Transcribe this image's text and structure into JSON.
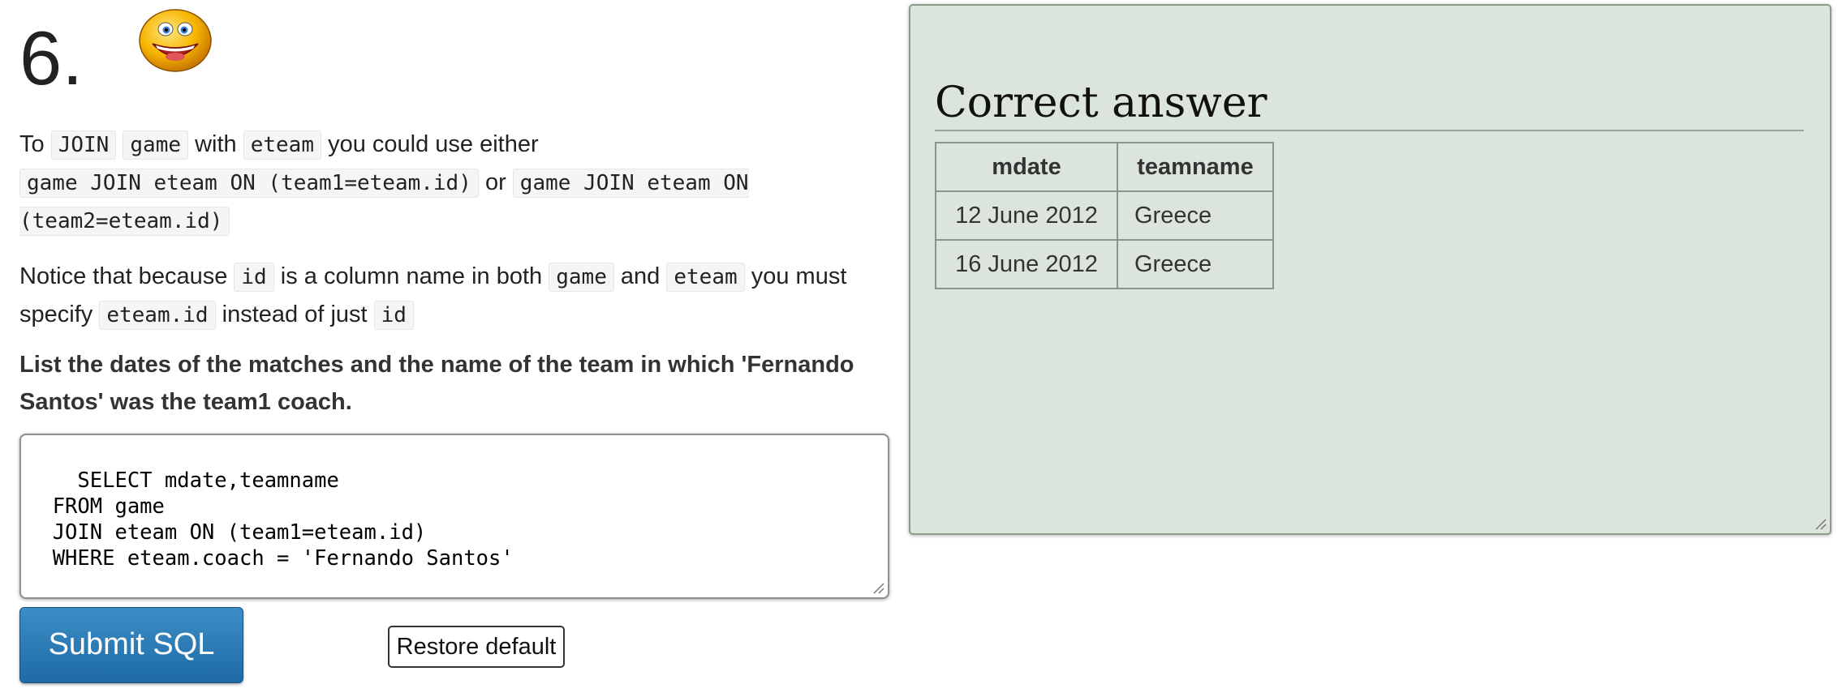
{
  "question_number": "6.",
  "smiley_icon": "grinning-smiley-icon",
  "intro": {
    "p1_to": "To",
    "p1_code_join": "JOIN",
    "p1_code_game": "game",
    "p1_with": "with",
    "p1_code_eteam": "eteam",
    "p1_either": "you could use either",
    "p1_code_option1": "game JOIN eteam ON (team1=eteam.id)",
    "p1_or": "or",
    "p1_code_option2": "game JOIN eteam ON (team2=eteam.id)",
    "p2_notice": "Notice that because",
    "p2_code_id": "id",
    "p2_is_col": "is a column name in both",
    "p2_code_game": "game",
    "p2_and": "and",
    "p2_code_eteam": "eteam",
    "p2_must": "you must specify",
    "p2_code_eteam_id": "eteam.id",
    "p2_instead": "instead of just",
    "p2_code_id2": "id"
  },
  "question": "List the dates of the matches and the name of the team in which 'Fernando Santos' was the team1 coach.",
  "sql_editor": {
    "value": "SELECT mdate,teamname\n  FROM game\n  JOIN eteam ON (team1=eteam.id)\n  WHERE eteam.coach = 'Fernando Santos'"
  },
  "buttons": {
    "submit": "Submit SQL",
    "restore": "Restore default"
  },
  "answer": {
    "title": "Correct answer",
    "columns": [
      "mdate",
      "teamname"
    ],
    "rows": [
      [
        "12 June 2012",
        "Greece"
      ],
      [
        "16 June 2012",
        "Greece"
      ]
    ],
    "panel_bg": "#dce5dc"
  },
  "colors": {
    "submit_button": "#2a7ab8",
    "answer_panel": "#dce5dc"
  }
}
